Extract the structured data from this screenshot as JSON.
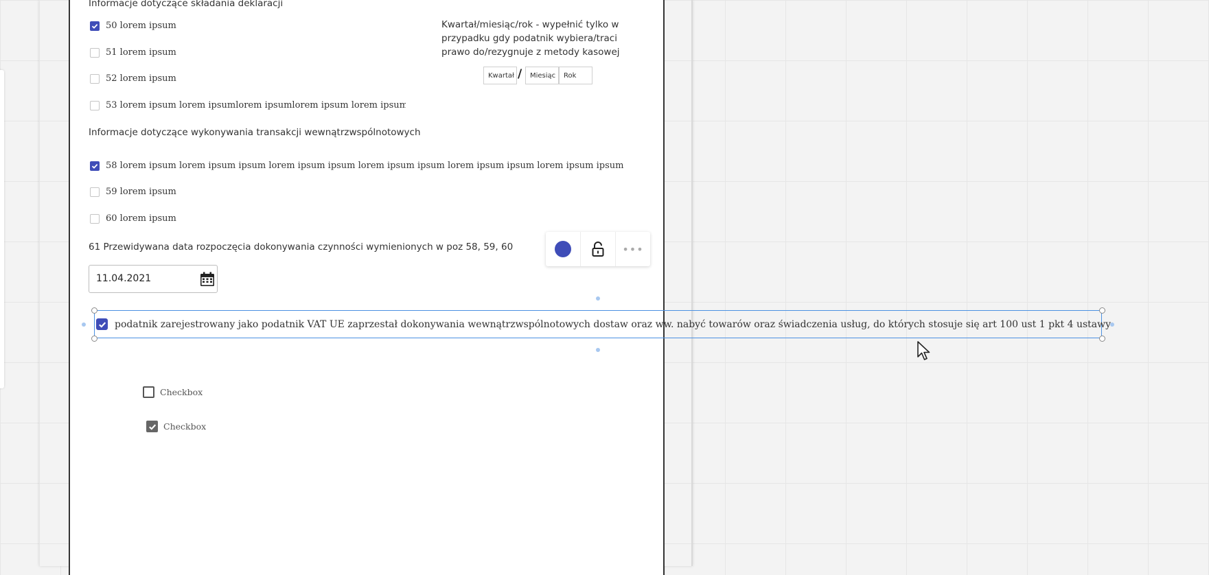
{
  "section1": {
    "title": "Informacje dotyczące składania deklaracji",
    "items": [
      {
        "label": "50 lorem ipsum",
        "checked": true
      },
      {
        "label": "51 lorem ipsum",
        "checked": false
      },
      {
        "label": "52 lorem ipsum",
        "checked": false
      },
      {
        "label": "53 lorem ipsum lorem ipsumlorem ipsumlorem ipsum   lorem ipsum",
        "checked": false
      }
    ]
  },
  "period": {
    "note_line1": "Kwartał/miesiąc/rok - wypełnić tylko w",
    "note_line2": "przypadku gdy podatnik wybiera/traci",
    "note_line3": "prawo do/rezygnuje z metody kasowej",
    "quarter_placeholder": "Kwartał",
    "slash": "/",
    "month_placeholder": "Miesiąc",
    "year_placeholder": "Rok"
  },
  "section2": {
    "title": "Informacje dotyczące wykonywania transakcji wewnątrzwspólnotowych",
    "items": [
      {
        "label": "58 lorem ipsum lorem ipsum ipsum lorem ipsum ipsum lorem ipsum ipsum lorem ipsum ipsum lorem ipsum ipsum",
        "checked": true
      },
      {
        "label": "59 lorem ipsum",
        "checked": false
      },
      {
        "label": "60 lorem ipsum",
        "checked": false
      }
    ]
  },
  "date_field": {
    "label": "61 Przewidywana data rozpoczęcia dokonywania czynności wymienionych w poz 58, 59, 60",
    "value": "11.04.2021"
  },
  "toolbar": {
    "color": "#3f4db8",
    "lock_icon": "unlock-icon",
    "more_icon": "more-icon",
    "more_glyph": "•••"
  },
  "selected_checkbox": {
    "label": "podatnik zarejestrowany jako podatnik VAT UE zaprzestał dokonywania wewnątrzwspólnotowych dostaw oraz ww. nabyć towarów oraz świadczenia usług, do których stosuje się art 100 ust 1 pkt 4 ustawy",
    "checked": true
  },
  "sample_checkboxes": [
    {
      "label": "Checkbox",
      "checked": false
    },
    {
      "label": "Checkbox",
      "checked": true
    }
  ],
  "colors": {
    "accent": "#3f4db8",
    "selection": "#4a90e2"
  }
}
